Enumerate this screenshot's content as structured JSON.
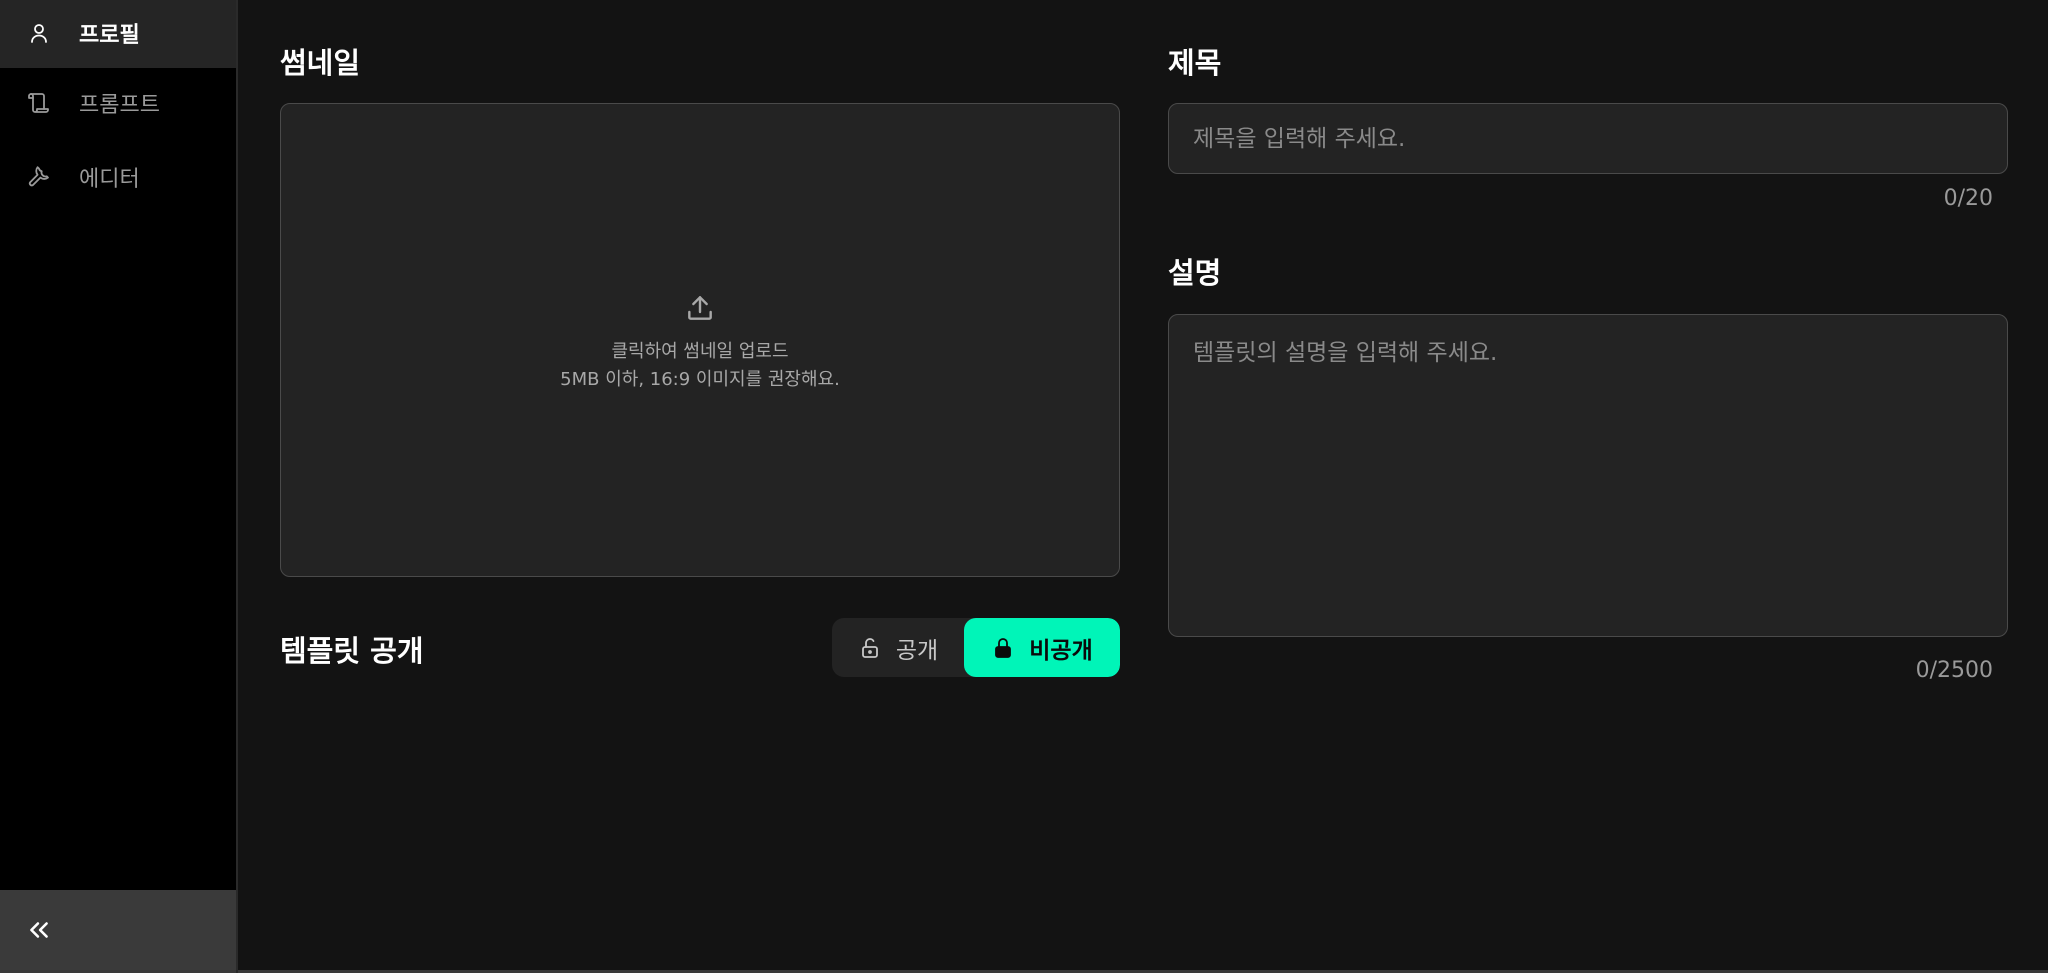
{
  "sidebar": {
    "items": [
      {
        "label": "프로필",
        "icon": "user-icon",
        "active": true
      },
      {
        "label": "프롬프트",
        "icon": "scroll-icon",
        "active": false
      },
      {
        "label": "에디터",
        "icon": "wrench-icon",
        "active": false
      }
    ],
    "collapse_icon": "double-chevron-left-icon"
  },
  "thumbnail": {
    "title": "썸네일",
    "upload_line1": "클릭하여 썸네일 업로드",
    "upload_line2": "5MB 이하, 16:9 이미지를 권장해요.",
    "icon": "upload-icon"
  },
  "title_field": {
    "label": "제목",
    "placeholder": "제목을 입력해 주세요.",
    "value": "",
    "counter": "0/20"
  },
  "description_field": {
    "label": "설명",
    "placeholder": "템플릿의 설명을 입력해 주세요.",
    "value": "",
    "counter": "0/2500"
  },
  "visibility": {
    "label": "템플릿 공개",
    "public_label": "공개",
    "private_label": "비공개",
    "selected": "private",
    "accent": "#00f5b8"
  }
}
